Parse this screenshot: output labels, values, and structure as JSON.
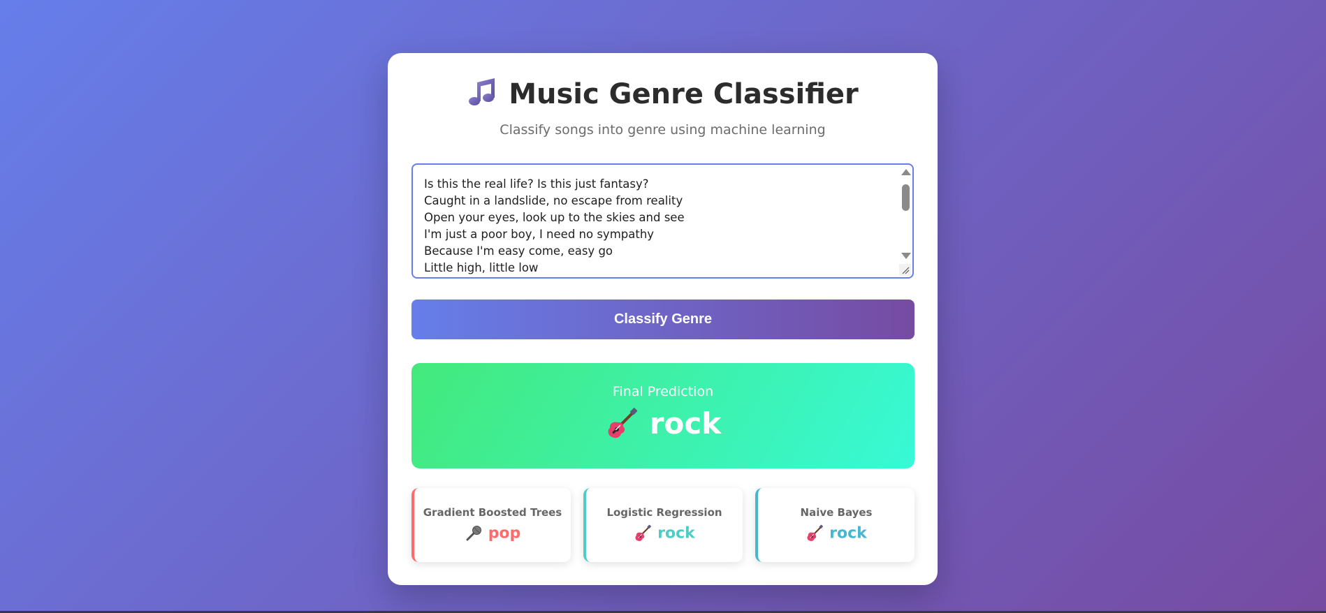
{
  "header": {
    "title": "Music Genre Classifier",
    "title_icon": "musical-notes-icon",
    "subtitle": "Classify songs into genre using machine learning"
  },
  "lyrics_input": {
    "value": "Is this the real life? Is this just fantasy?\nCaught in a landslide, no escape from reality\nOpen your eyes, look up to the skies and see\nI'm just a poor boy, I need no sympathy\nBecause I'm easy come, easy go\nLittle high, little low"
  },
  "classify_button": {
    "label": "Classify Genre"
  },
  "final_prediction": {
    "label": "Final Prediction",
    "genre": "rock",
    "icon": "guitar-icon"
  },
  "models": [
    {
      "name": "Gradient Boosted Trees",
      "prediction": "pop",
      "icon": "microphone-icon",
      "color": "#ff6b6b"
    },
    {
      "name": "Logistic Regression",
      "prediction": "rock",
      "icon": "guitar-icon",
      "color": "#4ecdc4"
    },
    {
      "name": "Naive Bayes",
      "prediction": "rock",
      "icon": "guitar-icon",
      "color": "#45b7d1"
    }
  ],
  "colors": {
    "gradient_start": "#667eea",
    "gradient_end": "#764ba2",
    "final_start": "#43e97b",
    "final_end": "#38f9d7"
  }
}
